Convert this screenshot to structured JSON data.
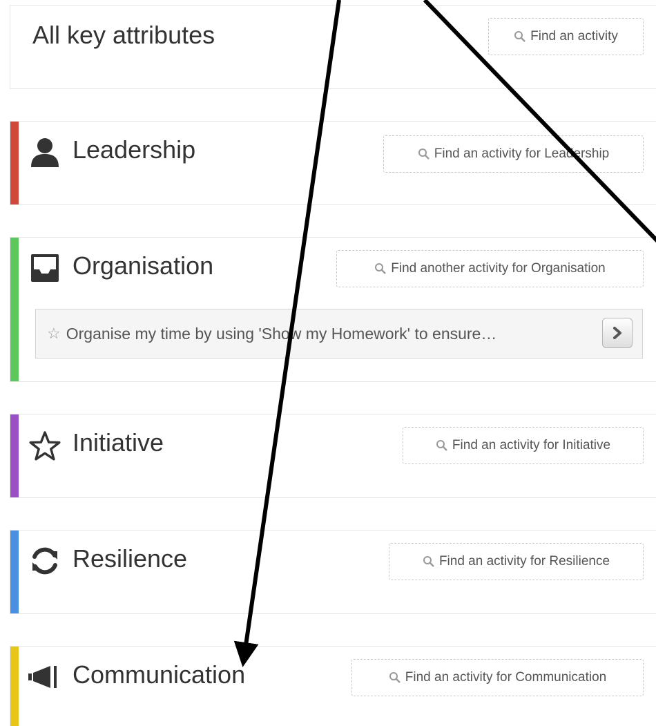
{
  "header": {
    "title": "All key attributes",
    "find_label": "Find an activity"
  },
  "attributes": [
    {
      "name": "Leadership",
      "icon": "user-icon",
      "color": "#d0483a",
      "find_label": "Find an activity for Leadership"
    },
    {
      "name": "Organisation",
      "icon": "inbox-icon",
      "color": "#5cc85c",
      "find_label": "Find another activity for Organisation",
      "activity": "Organise my time by using 'Show my Homework' to ensure…"
    },
    {
      "name": "Initiative",
      "icon": "star-icon",
      "color": "#9b4fc4",
      "find_label": "Find an activity for Initiative"
    },
    {
      "name": "Resilience",
      "icon": "refresh-icon",
      "color": "#4a90e2",
      "find_label": "Find an activity for Resilience"
    },
    {
      "name": "Communication",
      "icon": "bullhorn-icon",
      "color": "#e8c51a",
      "find_label": "Find an activity for Communication"
    }
  ]
}
